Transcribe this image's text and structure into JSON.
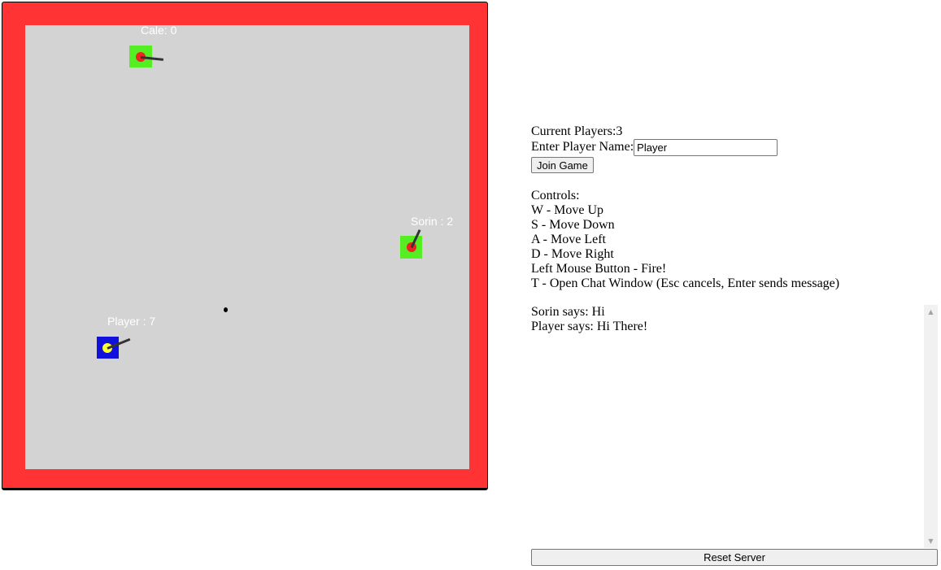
{
  "game": {
    "players": [
      {
        "label": "Cale: 0",
        "body_color": "#55ee22",
        "dot_color": "#ee2222",
        "is_self": false
      },
      {
        "label": "Sorin : 2",
        "body_color": "#55ee22",
        "dot_color": "#ee2222",
        "is_self": false
      },
      {
        "label": "Player : 7",
        "body_color": "#1111dd",
        "dot_color": "#ffff33",
        "is_self": true
      }
    ],
    "arena_color": "#d3d3d3",
    "wall_color": "#ff3333"
  },
  "panel": {
    "current_players_label": "Current Players:",
    "current_players_count": "3",
    "name_label": "Enter Player Name:",
    "name_value": "Player",
    "join_button": "Join Game",
    "controls_title": "Controls:",
    "controls": [
      "W - Move Up",
      "S - Move Down",
      "A - Move Left",
      "D - Move Right",
      "Left Mouse Button - Fire!",
      "T - Open Chat Window (Esc cancels, Enter sends message)"
    ]
  },
  "chat": {
    "messages": [
      "Sorin says: Hi",
      "Player says: Hi There!"
    ]
  },
  "reset_button": "Reset Server"
}
